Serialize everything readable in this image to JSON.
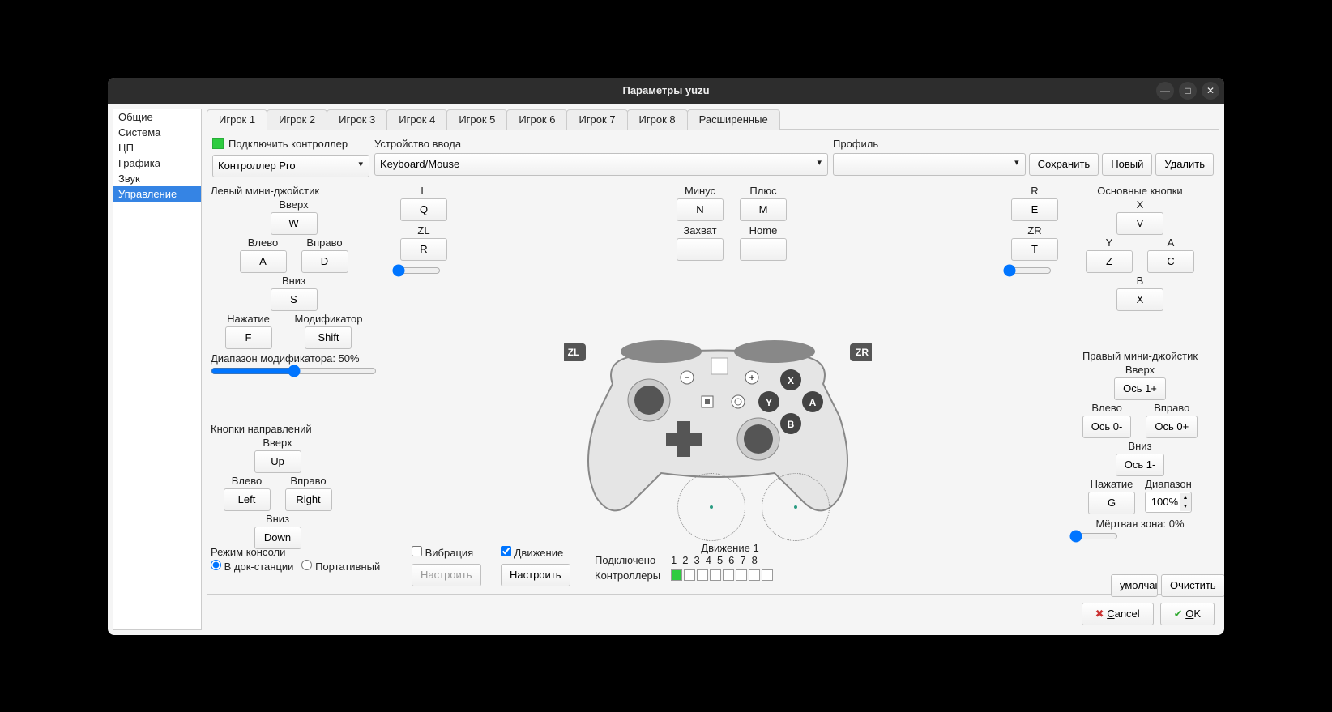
{
  "window_title": "Параметры yuzu",
  "sidebar": [
    "Общие",
    "Система",
    "ЦП",
    "Графика",
    "Звук",
    "Управление"
  ],
  "sidebar_active": 5,
  "tabs": [
    "Игрок 1",
    "Игрок 2",
    "Игрок 3",
    "Игрок 4",
    "Игрок 5",
    "Игрок 6",
    "Игрок 7",
    "Игрок 8",
    "Расширенные"
  ],
  "tab_active": 0,
  "connect_label": "Подключить контроллер",
  "controller_type": "Контроллер Pro",
  "input_device_label": "Устройство ввода",
  "input_device": "Keyboard/Mouse",
  "profile_label": "Профиль",
  "profile_value": "",
  "btn_save": "Сохранить",
  "btn_new": "Новый",
  "btn_delete": "Удалить",
  "left_stick": {
    "title": "Левый мини-джойстик",
    "up_lbl": "Вверх",
    "up": "W",
    "left_lbl": "Влево",
    "left": "A",
    "right_lbl": "Вправо",
    "right": "D",
    "down_lbl": "Вниз",
    "down": "S",
    "press_lbl": "Нажатие",
    "press": "F",
    "mod_lbl": "Модификатор",
    "mod": "Shift",
    "range_lbl": "Диапазон модификатора: 50%"
  },
  "dpad": {
    "title": "Кнопки направлений",
    "up_lbl": "Вверх",
    "up": "Up",
    "left_lbl": "Влево",
    "left": "Left",
    "right_lbl": "Вправо",
    "right": "Right",
    "down_lbl": "Вниз",
    "down": "Down"
  },
  "shoulder_left": {
    "l_lbl": "L",
    "l": "Q",
    "zl_lbl": "ZL",
    "zl": "R"
  },
  "shoulder_right": {
    "r_lbl": "R",
    "r": "E",
    "zr_lbl": "ZR",
    "zr": "T"
  },
  "minus_lbl": "Минус",
  "minus": "N",
  "plus_lbl": "Плюс",
  "plus": "M",
  "capture_lbl": "Захват",
  "capture": "",
  "home_lbl": "Home",
  "home": "",
  "face": {
    "title": "Основные кнопки",
    "x_lbl": "X",
    "x": "V",
    "y_lbl": "Y",
    "y": "Z",
    "a_lbl": "A",
    "a": "C",
    "b_lbl": "B",
    "b": "X"
  },
  "right_stick": {
    "title": "Правый мини-джойстик",
    "up_lbl": "Вверх",
    "up": "Ось 1+",
    "left_lbl": "Влево",
    "left": "Ось 0-",
    "right_lbl": "Вправо",
    "right": "Ось 0+",
    "down_lbl": "Вниз",
    "down": "Ось 1-",
    "press_lbl": "Нажатие",
    "press": "G",
    "range_lbl": "Диапазон",
    "range_val": "100%",
    "deadzone_lbl": "Мёртвая зона: 0%"
  },
  "console_mode": {
    "title": "Режим консоли",
    "docked": "В док-станции",
    "handheld": "Портативный"
  },
  "vibration": "Вибрация",
  "motion": "Движение",
  "config": "Настроить",
  "motion1": "Движение 1",
  "connected_lbl": "Подключено",
  "controllers_lbl": "Контроллеры",
  "numbers": [
    "1",
    "2",
    "3",
    "4",
    "5",
    "6",
    "7",
    "8"
  ],
  "defaults": "умолчани",
  "clear": "Очистить",
  "cancel": "Cancel",
  "ok": "OK",
  "zl_badge": "ZL",
  "zr_badge": "ZR"
}
